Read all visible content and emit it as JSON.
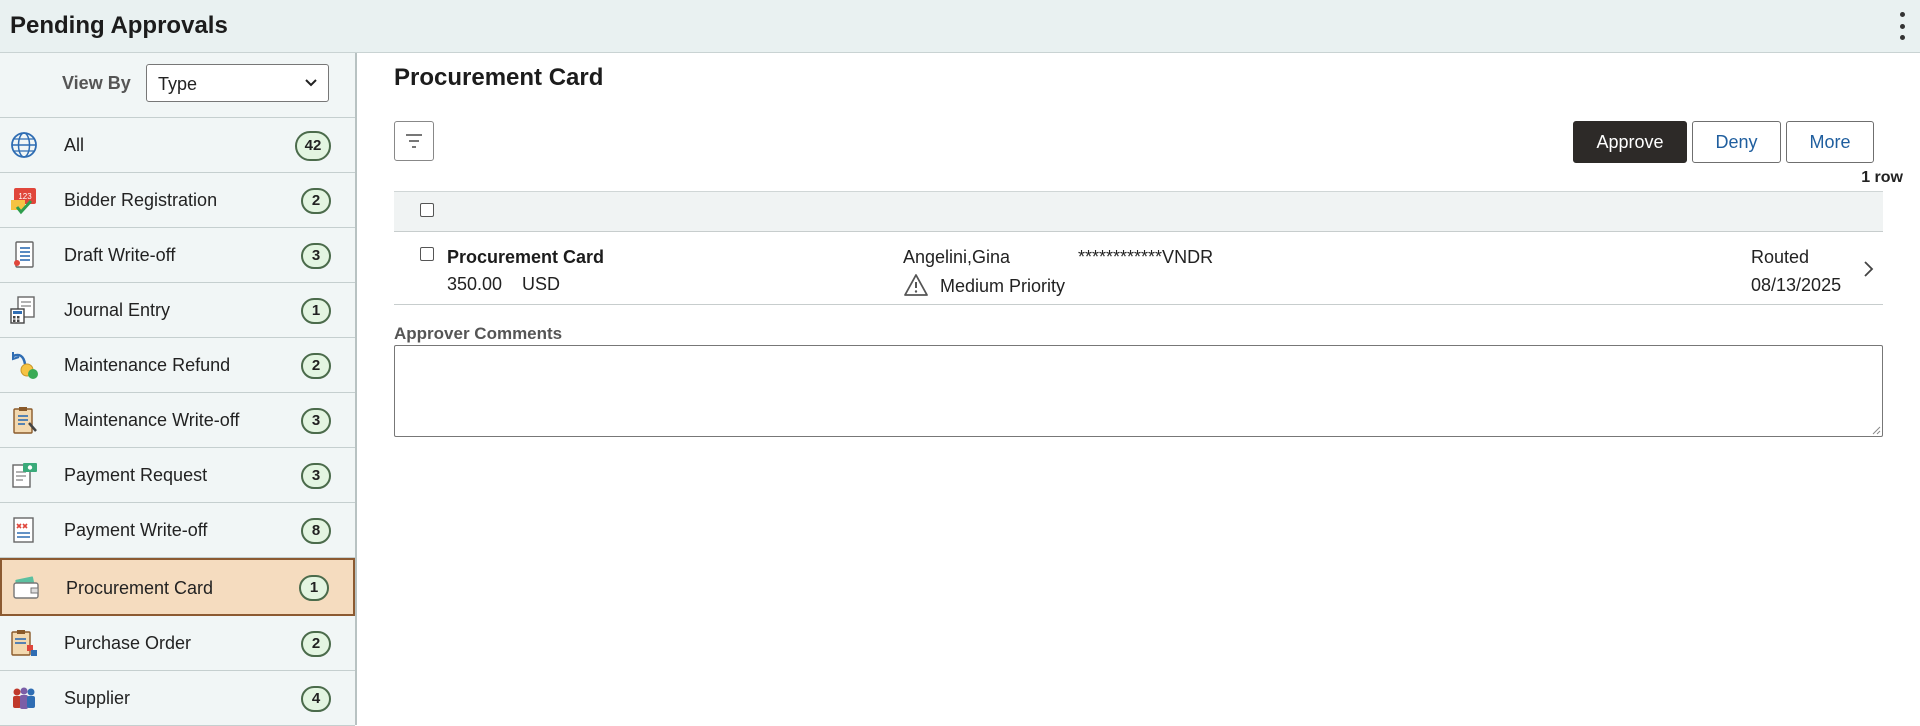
{
  "header": {
    "title": "Pending Approvals",
    "menu_icon": "kebab-menu-icon"
  },
  "sidebar": {
    "view_by_label": "View By",
    "view_by_value": "Type",
    "items": [
      {
        "label": "All",
        "count": "42",
        "icon": "globe-icon"
      },
      {
        "label": "Bidder Registration",
        "count": "2",
        "icon": "calendar-check-icon"
      },
      {
        "label": "Draft Write-off",
        "count": "3",
        "icon": "document-list-icon"
      },
      {
        "label": "Journal Entry",
        "count": "1",
        "icon": "calculator-document-icon"
      },
      {
        "label": "Maintenance Refund",
        "count": "2",
        "icon": "refund-arrow-icon"
      },
      {
        "label": "Maintenance Write-off",
        "count": "3",
        "icon": "clipboard-wrench-icon"
      },
      {
        "label": "Payment Request",
        "count": "3",
        "icon": "payment-document-icon"
      },
      {
        "label": "Payment Write-off",
        "count": "8",
        "icon": "document-cross-icon"
      },
      {
        "label": "Procurement Card",
        "count": "1",
        "icon": "wallet-card-icon",
        "active": true
      },
      {
        "label": "Purchase Order",
        "count": "2",
        "icon": "clipboard-shapes-icon"
      },
      {
        "label": "Supplier",
        "count": "4",
        "icon": "people-group-icon"
      }
    ]
  },
  "main": {
    "title": "Procurement Card",
    "actions": {
      "approve": "Approve",
      "deny": "Deny",
      "more": "More"
    },
    "row_count": "1 row",
    "rows": [
      {
        "title": "Procurement Card",
        "amount": "350.00",
        "currency": "USD",
        "name": "Angelini,Gina",
        "vendor": "************VNDR",
        "priority": "Medium Priority",
        "status": "Routed",
        "date": "08/13/2025"
      }
    ],
    "comments_label": "Approver Comments",
    "comments_value": ""
  },
  "colors": {
    "header_bg": "#e9f1f1",
    "sidebar_bg": "#f1f6f6",
    "active_item_bg": "#f5dcbf",
    "active_item_border": "#8c5a31",
    "approve_bg": "#2d2a28",
    "link_blue": "#1f5e9e",
    "badge_bg": "#e3f5e1"
  }
}
